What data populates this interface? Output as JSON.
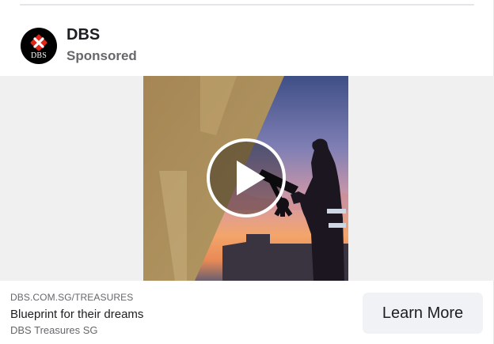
{
  "post": {
    "page_name": "DBS",
    "sponsored_label": "Sponsored",
    "avatar_wordmark": "DBS",
    "avatar_icon": "dbs-logo-icon"
  },
  "media": {
    "type": "video",
    "play_icon": "play-icon",
    "colors": {
      "gold": "#b4975a",
      "sky_top": "#5b6fa8",
      "sunset": "#f2a06a"
    }
  },
  "link": {
    "domain": "DBS.COM.SG/TREASURES",
    "headline": "Blueprint for their dreams",
    "description": "DBS Treasures SG",
    "cta_label": "Learn More"
  },
  "colors": {
    "brand_red": "#e1261c",
    "text_primary": "#1c1e21",
    "text_secondary": "#65676b",
    "button_bg": "#f0f2f5"
  }
}
